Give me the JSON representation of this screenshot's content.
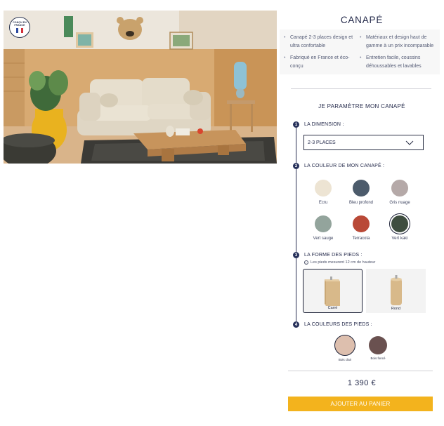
{
  "colors": {
    "accent": "#f3b31d",
    "navy": "#26305a"
  },
  "badge": {
    "text": "CONÇU EN FRANCE",
    "icon": "france-flag-icon"
  },
  "product": {
    "title": "CANAPÉ",
    "features": [
      "Canapé 2-3 places design et ultra confortable",
      "Matériaux et design haut de gamme à un prix incomparable",
      "Fabriqué en France et éco-conçu",
      "Entretien facile, coussins déhoussables et lavables"
    ]
  },
  "configurator": {
    "title": "JE PARAMÈTRE MON CANAPÉ",
    "steps": [
      {
        "number": "1",
        "label": "LA DIMENSION :"
      },
      {
        "number": "2",
        "label": "LA COULEUR DE MON CANAPÉ :"
      },
      {
        "number": "3",
        "label": "LA FORME DES PIEDS :"
      },
      {
        "number": "4",
        "label": "LA COULEURS DES PIEDS :"
      }
    ],
    "dimension": {
      "selected": "2-3 PLACES",
      "icon": "chevron-down-icon"
    },
    "sofa_colors": [
      {
        "label": "Ecru",
        "hex": "#ede4d3",
        "selected": false
      },
      {
        "label": "Bleu profond",
        "hex": "#4c5b6b",
        "selected": false
      },
      {
        "label": "Gris nuage",
        "hex": "#b5a9a8",
        "selected": false
      },
      {
        "label": "Vert sauge",
        "hex": "#93a49c",
        "selected": false
      },
      {
        "label": "Terracota",
        "hex": "#b94937",
        "selected": false
      },
      {
        "label": "Vert kaki",
        "hex": "#3e4d3f",
        "selected": true
      }
    ],
    "feet_note": "Les pieds mesurent 12 cm de hauteur",
    "feet_shapes": [
      {
        "label": "Carré",
        "selected": true
      },
      {
        "label": "Rond",
        "selected": false
      }
    ],
    "feet_colors": [
      {
        "label": "Bois clair",
        "hex": "#ddbfae",
        "selected": true
      },
      {
        "label": "Bois foncé",
        "hex": "#6a5150",
        "selected": false
      }
    ]
  },
  "price": "1 390 €",
  "cart_button": "AJOUTER AU PANIER"
}
